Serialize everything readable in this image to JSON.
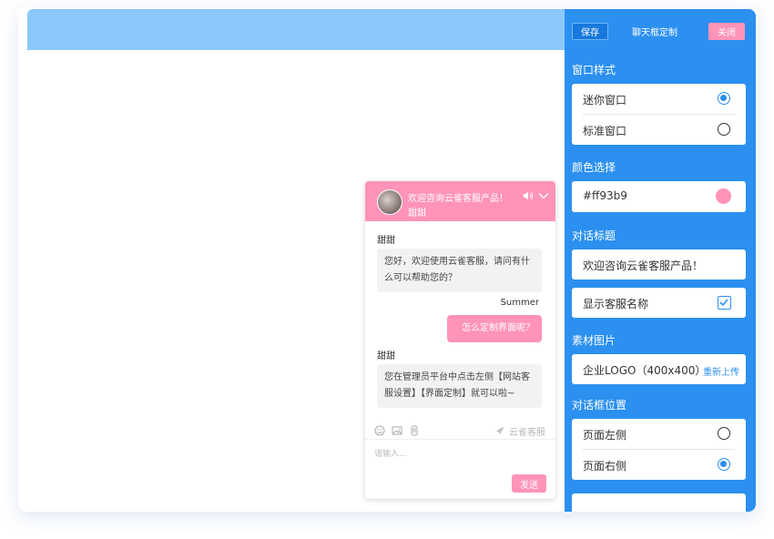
{
  "chat": {
    "title": "欢迎咨询云雀客服产品！",
    "agent_name": "甜甜",
    "messages": [
      {
        "sender": "甜甜",
        "text_line1": "您好，欢迎使用云雀客服，请问有什",
        "text_line2": "么可以帮助您的？"
      },
      {
        "sender": "Summer",
        "text": "怎么定制界面呢？"
      },
      {
        "sender": "甜甜",
        "text_line1": "您在管理员平台中点击左侧【网站客",
        "text_line2": "服设置】【界面定制】就可以啦~"
      }
    ],
    "brand": "云雀客服",
    "input_placeholder": "请输入...",
    "send_label": "发送",
    "accent_color": "#ff93b9"
  },
  "panel": {
    "save_label": "保存",
    "title": "聊天框定制",
    "close_label": "关闭",
    "window_style": {
      "label": "窗口样式",
      "options": [
        {
          "label": "迷你窗口",
          "selected": true
        },
        {
          "label": "标准窗口",
          "selected": false
        }
      ]
    },
    "color": {
      "label": "颜色选择",
      "value": "#ff93b9"
    },
    "dialog_title": {
      "label": "对话标题",
      "value": "欢迎咨询云雀客服产品！",
      "show_agent_label": "显示客服名称",
      "show_agent_checked": true
    },
    "material": {
      "label": "素材图片",
      "logo_label": "企业LOGO（400x400）",
      "reupload_label": "重新上传"
    },
    "position": {
      "label": "对话框位置",
      "options": [
        {
          "label": "页面左侧",
          "selected": false
        },
        {
          "label": "页面右侧",
          "selected": true
        }
      ]
    },
    "panel_color": "#2b90ef"
  },
  "stage": {
    "topbar_color": "#8cc8fb"
  }
}
